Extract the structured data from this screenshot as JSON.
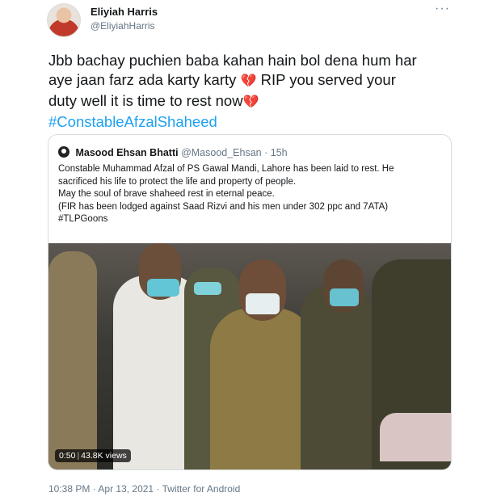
{
  "author": {
    "name": "Eliyiah Harris",
    "handle": "@EliyiahHarris"
  },
  "icons": {
    "more": "more-options-icon",
    "heart": "broken-heart-icon",
    "avatar": "user-avatar"
  },
  "tweet": {
    "line1": "Jbb bachay puchien baba kahan hain bol dena hum har",
    "line2_a": "aye jaan farz ada karty karty",
    "line2_b": "RIP you served your",
    "line3": "duty well it is time to rest now",
    "heart": "💔",
    "hashtag": "#ConstableAfzalShaheed"
  },
  "quote": {
    "name": "Masood Ehsan Bhatti",
    "handle": "@Masood_Ehsan",
    "dot": "·",
    "time": "15h",
    "lines": [
      "Constable Muhammad Afzal of PS Gawal Mandi, Lahore has been laid to rest. He",
      "sacrificed his life to protect the life and property of people.",
      "May the soul of brave shaheed rest in eternal peace.",
      "(FIR has been lodged against Saad Rizvi and his men under 302 ppc and 7ATA)",
      "#TLPGoons"
    ],
    "video": {
      "duration": "0:50",
      "views": "43.8K views"
    }
  },
  "footer": {
    "time": "10:38 PM",
    "date": "Apr 13, 2021",
    "source": "Twitter for Android",
    "sep": "·"
  },
  "colors": {
    "link": "#1da1f2",
    "secondary_text": "#657786",
    "heart": "#d0243a"
  }
}
